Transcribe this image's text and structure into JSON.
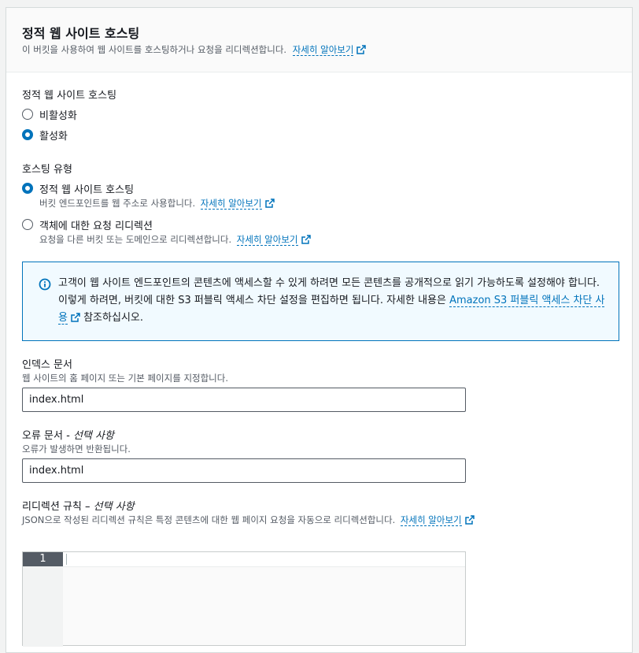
{
  "header": {
    "title": "정적 웹 사이트 호스팅",
    "description": "이 버킷을 사용하여 웹 사이트를 호스팅하거나 요청을 리디렉션합니다.",
    "learn_more": "자세히 알아보기"
  },
  "hosting_toggle": {
    "label": "정적 웹 사이트 호스팅",
    "options": [
      {
        "label": "비활성화",
        "selected": false
      },
      {
        "label": "활성화",
        "selected": true
      }
    ]
  },
  "hosting_type": {
    "label": "호스팅 유형",
    "options": [
      {
        "label": "정적 웹 사이트 호스팅",
        "description": "버킷 엔드포인트를 웹 주소로 사용합니다.",
        "learn_more": "자세히 알아보기",
        "selected": true
      },
      {
        "label": "객체에 대한 요청 리디렉션",
        "description": "요청을 다른 버킷 또는 도메인으로 리디렉션합니다.",
        "learn_more": "자세히 알아보기",
        "selected": false
      }
    ]
  },
  "info_alert": {
    "text_1": "고객이 웹 사이트 엔드포인트의 콘텐츠에 액세스할 수 있게 하려면 모든 콘텐츠를 공개적으로 읽기 가능하도록 설정해야 합니다. 이렇게 하려면, 버킷에 대한 S3 퍼블릭 액세스 차단 설정을 편집하면 됩니다. 자세한 내용은 ",
    "link": "Amazon S3 퍼블릭 액세스 차단 사용",
    "text_2": " 참조하십시오."
  },
  "index_document": {
    "label": "인덱스 문서",
    "description": "웹 사이트의 홈 페이지 또는 기본 페이지를 지정합니다.",
    "value": "index.html"
  },
  "error_document": {
    "label": "오류 문서",
    "optional": "- 선택 사항",
    "description": "오류가 발생하면 반환됩니다.",
    "value": "index.html"
  },
  "redirect_rules": {
    "label": "리디렉션 규칙",
    "optional": "– 선택 사항",
    "description": "JSON으로 작성된 리디렉션 규칙은 특정 콘텐츠에 대한 웹 페이지 요청을 자동으로 리디렉션합니다.",
    "learn_more": "자세히 알아보기",
    "line_number": "1"
  },
  "colors": {
    "accent": "#0073bb",
    "info_bg": "#f1faff",
    "text": "#16191f",
    "secondary_text": "#545b64"
  }
}
